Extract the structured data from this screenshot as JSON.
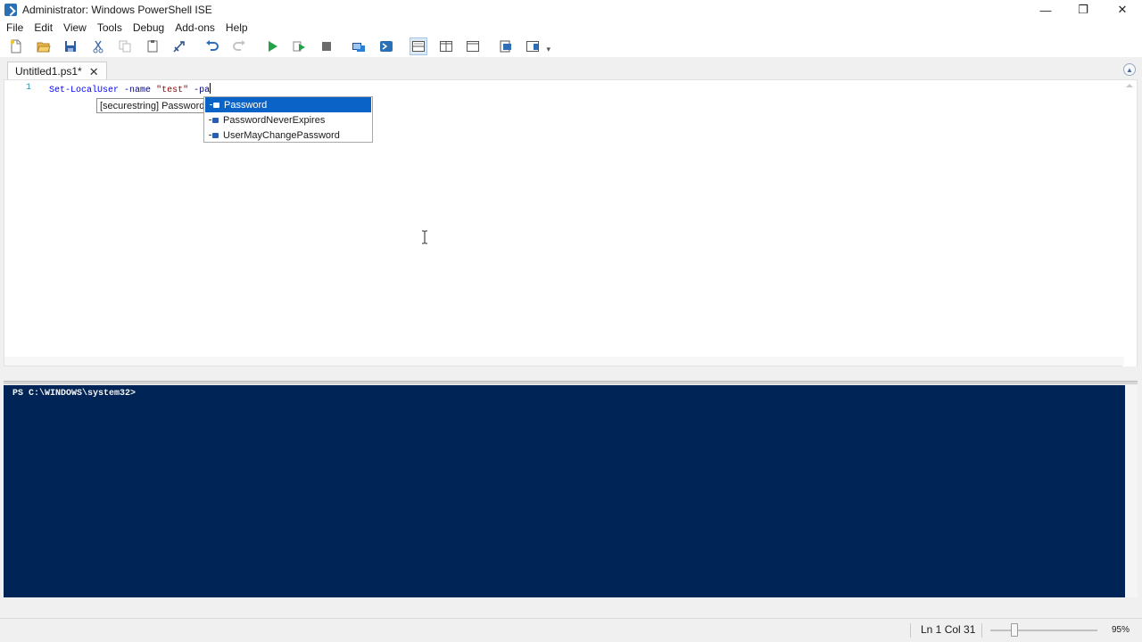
{
  "window": {
    "title": "Administrator: Windows PowerShell ISE",
    "controls": {
      "minimize": "—",
      "restore": "❐",
      "close": "✕"
    }
  },
  "menu": {
    "items": [
      "File",
      "Edit",
      "View",
      "Tools",
      "Debug",
      "Add-ons",
      "Help"
    ]
  },
  "toolbar": {
    "buttons": [
      "new-script",
      "open",
      "save",
      "cut",
      "copy",
      "paste",
      "clear-console",
      "undo",
      "redo",
      "run-script",
      "run-selection",
      "stop",
      "new-remote-tab",
      "start-powershell-exe",
      "show-script-pane-top",
      "show-script-pane-right",
      "show-script-pane-maximized",
      "show-command-window",
      "show-command-addon"
    ]
  },
  "tabs": [
    {
      "label": "Untitled1.ps1*",
      "close": "✕"
    }
  ],
  "editor": {
    "line_number": "1",
    "tokens": {
      "command": "Set-LocalUser",
      "param1": "-name",
      "string": "\"test\"",
      "param2": "-pa"
    },
    "tooltip": "[securestring] Password",
    "completions": [
      {
        "label": "Password",
        "selected": true
      },
      {
        "label": "PasswordNeverExpires",
        "selected": false
      },
      {
        "label": "UserMayChangePassword",
        "selected": false
      }
    ]
  },
  "console": {
    "prompt": "PS C:\\WINDOWS\\system32>"
  },
  "status": {
    "position": "Ln 1  Col 31",
    "zoom": "95%",
    "zoom_level_percent": 95
  },
  "colors": {
    "console_bg": "#012456",
    "selection": "#0a64c8"
  }
}
